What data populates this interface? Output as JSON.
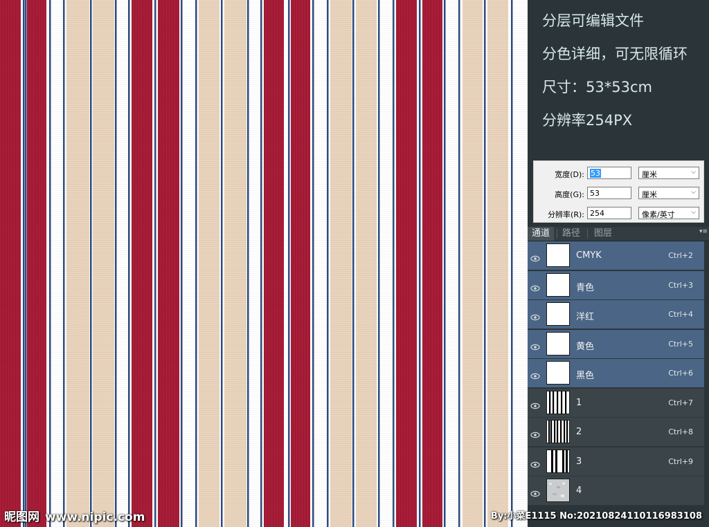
{
  "pattern": {
    "colors": {
      "red": "#a51a35",
      "beige": "#e9d3bc",
      "white": "#ffffff",
      "navy": "#2c4a7e"
    }
  },
  "watermark": {
    "site_cn": "昵图网",
    "site_url": "www.nipic.com",
    "credit": "By:小菜E1115 No:20210824110116983108"
  },
  "info": {
    "lines": [
      "分层可编辑文件",
      "分色详细，可无限循环",
      "尺寸：53*53cm",
      "分辨率254PX"
    ]
  },
  "image_size": {
    "rows": [
      {
        "label": "宽度(D):",
        "value": "53",
        "unit": "厘米",
        "focused": true
      },
      {
        "label": "高度(G):",
        "value": "53",
        "unit": "厘米",
        "focused": false
      },
      {
        "label": "分辨率(R):",
        "value": "254",
        "unit": "像素/英寸",
        "focused": false
      }
    ]
  },
  "panel": {
    "tabs": [
      "通道",
      "路径",
      "图层"
    ],
    "active_tab": 0,
    "channels": [
      {
        "name": "CMYK",
        "shortcut": "Ctrl+2",
        "selected": true,
        "thumb": "white-thumb-icon"
      },
      {
        "name": "青色",
        "shortcut": "Ctrl+3",
        "selected": true,
        "thumb": "white-thumb-icon"
      },
      {
        "name": "洋红",
        "shortcut": "Ctrl+4",
        "selected": true,
        "thumb": "white-thumb-icon"
      },
      {
        "name": "黄色",
        "shortcut": "Ctrl+5",
        "selected": true,
        "thumb": "white-thumb-icon"
      },
      {
        "name": "黑色",
        "shortcut": "Ctrl+6",
        "selected": true,
        "thumb": "white-thumb-icon"
      },
      {
        "name": "1",
        "shortcut": "Ctrl+7",
        "selected": false,
        "thumb": "stripes-thumb-icon"
      },
      {
        "name": "2",
        "shortcut": "Ctrl+8",
        "selected": false,
        "thumb": "stripes-thumb-icon"
      },
      {
        "name": "3",
        "shortcut": "Ctrl+9",
        "selected": false,
        "thumb": "stripes-thumb-icon"
      },
      {
        "name": "4",
        "shortcut": "",
        "selected": false,
        "thumb": "noise-thumb-icon"
      }
    ]
  }
}
